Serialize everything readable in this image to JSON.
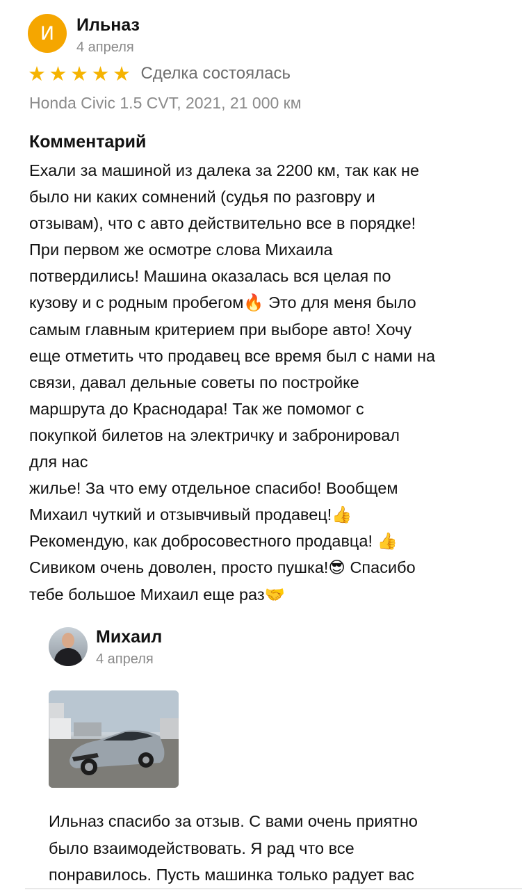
{
  "review": {
    "avatar_letter": "И",
    "author": "Ильназ",
    "date": "4 апреля",
    "stars": [
      "★",
      "★",
      "★",
      "★",
      "★"
    ],
    "rating": 5,
    "deal_status": "Сделка состоялась",
    "car": "Honda Civic 1.5 CVT, 2021, 21 000 км",
    "comment_title": "Комментарий",
    "comment_lines": [
      "Ехали за машиной из далека за 2200 км, так как не",
      "было ни каких сомнений (судья по разговру и",
      "отзывам), что с авто действительно все в порядке!",
      "При первом же осмотре слова Михаила",
      "потвердились! Машина оказалась вся целая по",
      "кузову и с родным пробегом🔥 Это для меня было",
      "самым главным критерием при выборе авто! Хочу",
      "еще отметить что продавец все время был с нами на",
      "связи, давал дельные советы по постройке",
      "маршрута до Краснодара! Так же помомог с",
      "покупкой билетов на электричку и забронировал",
      "для нас",
      "жилье! За что ему отдельное спасибо! Вообщем",
      "Михаил чуткий и отзывчивый продавец!👍",
      "Рекомендую, как добросовестного продавца! 👍",
      "Сивиком очень доволен, просто пушка!😎  Спасибо",
      "тебе большое Михаил еще раз🤝"
    ]
  },
  "reply": {
    "author": "Михаил",
    "date": "4 апреля",
    "photo_icon": "car-photo",
    "lines": [
      "Ильназ спасибо за отзыв. С вами очень приятно",
      "было взаимодействовать. Я рад что все",
      "понравилось. Пусть машинка только радует вас"
    ]
  },
  "colors": {
    "avatar_bg": "#f5a600",
    "star": "#f5b301",
    "muted_text": "#8a8a8a",
    "text": "#111111"
  }
}
